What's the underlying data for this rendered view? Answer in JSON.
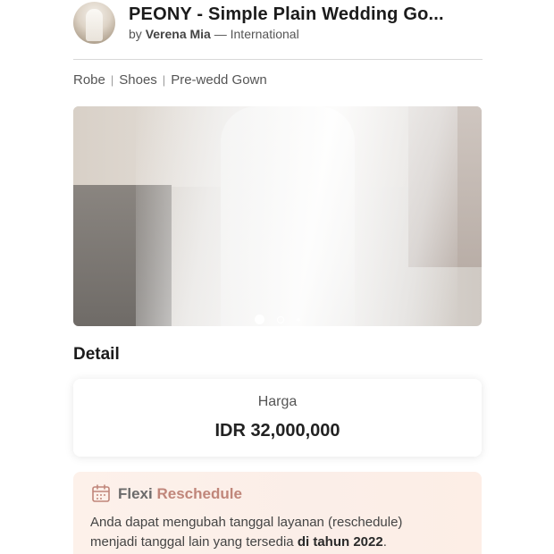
{
  "header": {
    "title": "PEONY - Simple Plain Wedding Go...",
    "by_prefix": "by",
    "author": "Verena Mia",
    "region_sep": "—",
    "region": "International"
  },
  "categories": [
    "Robe",
    "Shoes",
    "Pre-wedd Gown"
  ],
  "category_separator": "|",
  "carousel": {
    "slides_count": 3,
    "active_slide": 1
  },
  "detail": {
    "section_title": "Detail",
    "price_label": "Harga",
    "price_value": "IDR 32,000,000"
  },
  "flexi": {
    "title_part1": "Flexi",
    "title_part2": "Reschedule",
    "icon": "calendar-icon",
    "text_line1": "Anda dapat mengubah tanggal layanan (reschedule)",
    "text_line2": "menjadi tanggal lain yang tersedia",
    "text_emphasis": "di tahun 2022",
    "text_end": "."
  },
  "colors": {
    "accent": "#c0867a",
    "card_bg": "#fdf1ea"
  }
}
